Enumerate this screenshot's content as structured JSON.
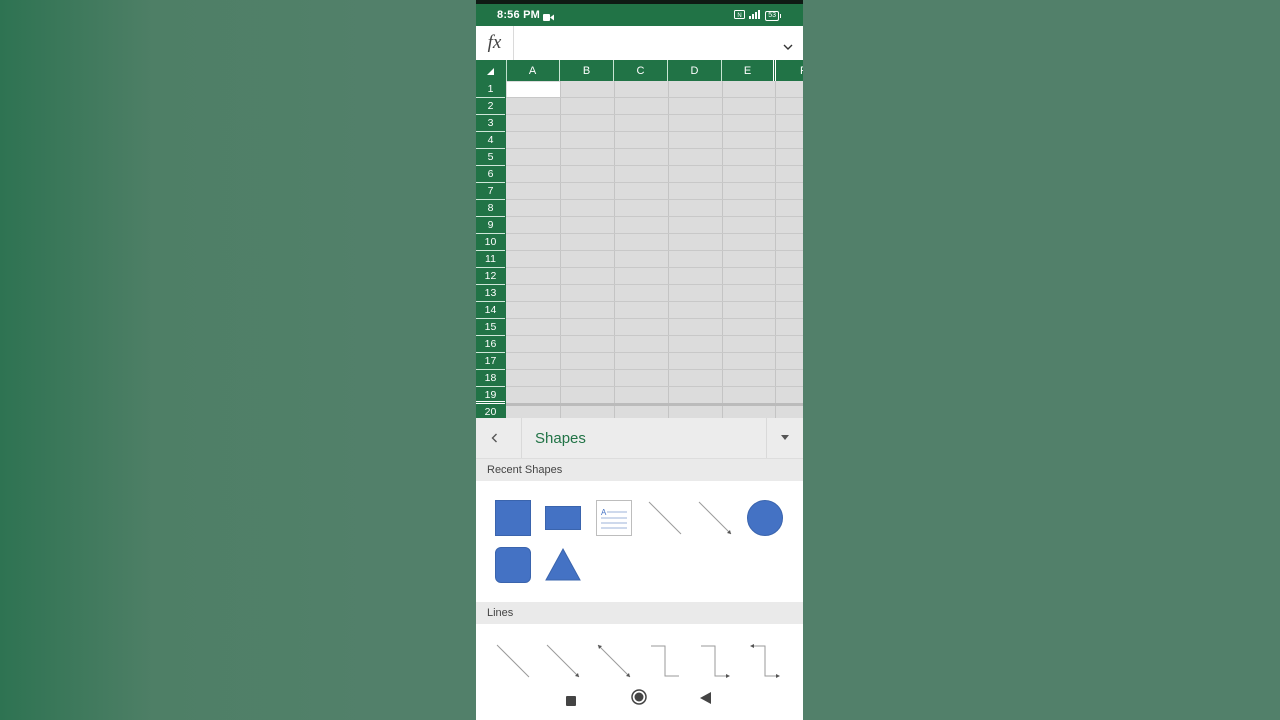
{
  "status_bar": {
    "time": "8:56 PM",
    "battery": "53"
  },
  "formula_bar": {
    "fx_label": "fx",
    "value": ""
  },
  "grid": {
    "columns": [
      "A",
      "B",
      "C",
      "D",
      "E",
      "F"
    ],
    "rows": [
      "1",
      "2",
      "3",
      "4",
      "5",
      "6",
      "7",
      "8",
      "9",
      "10",
      "11",
      "12",
      "13",
      "14",
      "15",
      "16",
      "17",
      "18",
      "19",
      "20"
    ]
  },
  "shapes_panel": {
    "title": "Shapes",
    "recent_label": "Recent Shapes",
    "lines_label": "Lines",
    "recent_shapes": [
      "square",
      "rectangle",
      "text-box",
      "line",
      "arrow-line",
      "oval",
      "rounded-rectangle",
      "triangle"
    ],
    "line_shapes": [
      "line",
      "arrow",
      "double-arrow",
      "elbow-connector",
      "elbow-arrow-connector",
      "elbow-double-arrow-connector"
    ]
  },
  "colors": {
    "excel_green": "#217346",
    "shape_blue": "#4472c4"
  },
  "icons": [
    "video-camera-icon",
    "nfc-icon",
    "signal-icon",
    "battery-icon",
    "chevron-down-icon",
    "chevron-left-icon",
    "caret-down-icon",
    "stop-icon",
    "home-icon",
    "back-icon"
  ]
}
